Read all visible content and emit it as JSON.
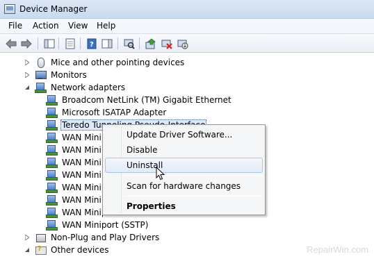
{
  "window": {
    "title": "Device Manager"
  },
  "menubar": {
    "items": [
      "File",
      "Action",
      "View",
      "Help"
    ]
  },
  "toolbar": {
    "buttons": [
      "back-icon",
      "forward-icon",
      "show-hide-console-tree-icon",
      "properties-icon",
      "help-icon",
      "show-action-pane-icon",
      "scan-hardware-icon",
      "update-driver-icon",
      "uninstall-icon",
      "disable-icon"
    ]
  },
  "tree": {
    "categories": {
      "mice": "Mice and other pointing devices",
      "monitors": "Monitors",
      "network": "Network adapters",
      "non_plug": "Non-Plug and Play Drivers",
      "other": "Other devices"
    },
    "network_children": [
      "Broadcom NetLink (TM) Gigabit Ethernet",
      "Microsoft ISATAP Adapter",
      "Teredo Tunneling Pseudo-Interface",
      "WAN Minip",
      "WAN Minip",
      "WAN Minip",
      "WAN Minip",
      "WAN Minip",
      "WAN Minip",
      "WAN Minip",
      "WAN Miniport (SSTP)"
    ],
    "selected_index": 2
  },
  "context_menu": {
    "items": {
      "update": "Update Driver Software...",
      "disable": "Disable",
      "uninstall": "Uninstall",
      "scan": "Scan for hardware changes",
      "properties": "Properties"
    },
    "hovered": "Uninstall"
  },
  "watermark": "RepairWin.com",
  "colors": {
    "selection": "#dfe9f7",
    "hover_border": "#a8c4e6",
    "titlebar": "#dbe7f5"
  }
}
